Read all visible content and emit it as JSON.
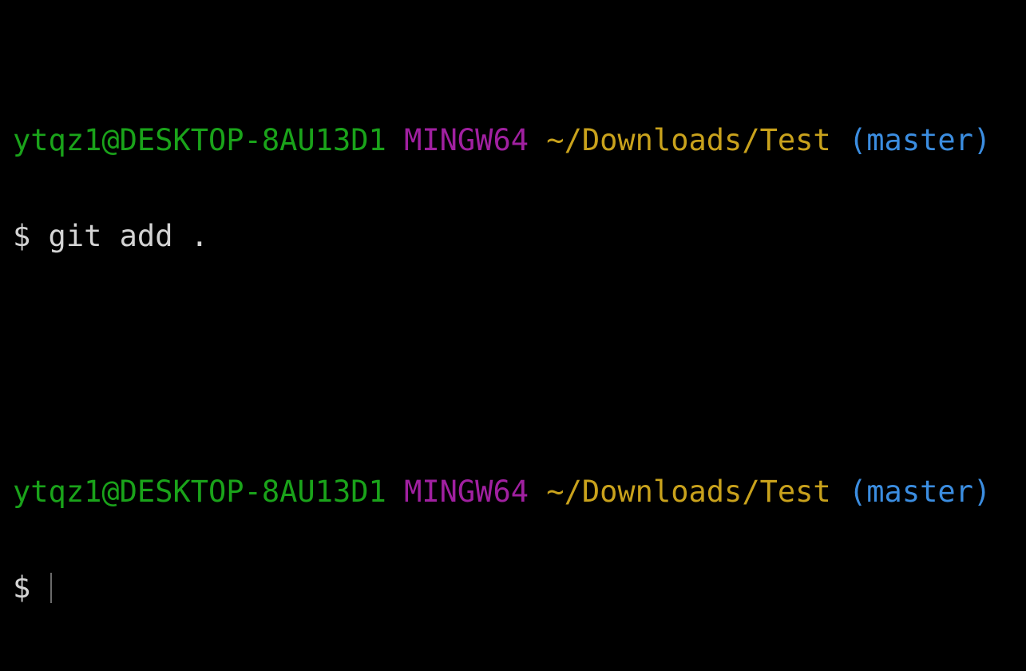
{
  "colors": {
    "background": "#000000",
    "user": "#1aa31a",
    "host": "#a020a0",
    "path": "#c9a21c",
    "branch": "#3b8de0",
    "command": "#d4d4d4"
  },
  "blocks": [
    {
      "prompt": {
        "user_host": "ytqz1@DESKTOP-8AU13D1",
        "shell": "MINGW64",
        "path": "~/Downloads/Test",
        "branch": "(master)"
      },
      "input": "$ git add ."
    },
    {
      "prompt": {
        "user_host": "ytqz1@DESKTOP-8AU13D1",
        "shell": "MINGW64",
        "path": "~/Downloads/Test",
        "branch": "(master)"
      },
      "input": "$ "
    }
  ]
}
